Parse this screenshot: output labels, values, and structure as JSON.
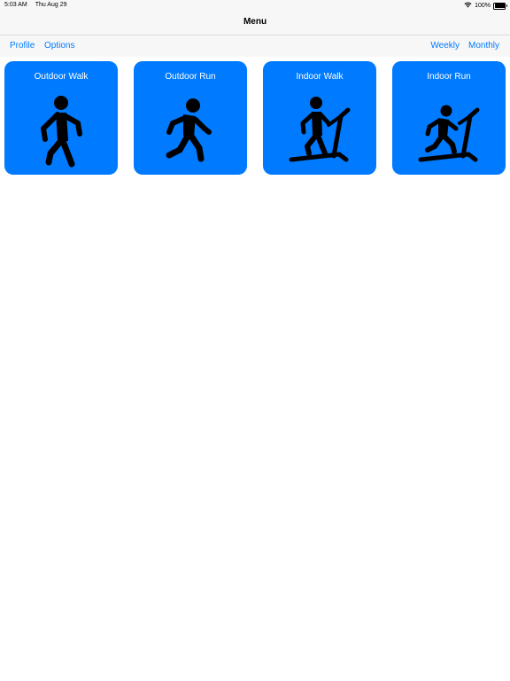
{
  "status_bar": {
    "time": "5:03 AM",
    "date": "Thu Aug 29",
    "battery_percent": "100%",
    "battery_level": 1.0
  },
  "nav": {
    "title": "Menu"
  },
  "toolbar": {
    "profile_label": "Profile",
    "options_label": "Options",
    "weekly_label": "Weekly",
    "monthly_label": "Monthly"
  },
  "tiles": [
    {
      "label": "Outdoor Walk",
      "icon": "walking-person-icon"
    },
    {
      "label": "Outdoor Run",
      "icon": "running-person-icon"
    },
    {
      "label": "Indoor Walk",
      "icon": "treadmill-walk-icon"
    },
    {
      "label": "Indoor Run",
      "icon": "treadmill-run-icon"
    }
  ],
  "colors": {
    "accent": "#007aff",
    "tile_background": "#007aff",
    "tile_text": "#ffffff",
    "bar_background": "#f7f7f7"
  }
}
